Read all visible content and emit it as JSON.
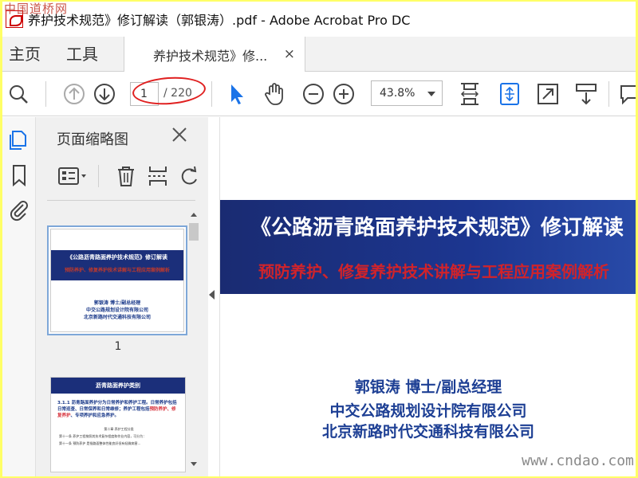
{
  "window": {
    "title": "养护技术规范》修订解读（郭银涛）.pdf - Adobe Acrobat Pro DC",
    "watermark_top": "中国道桥网",
    "watermark_bottom": "www.cndao.com"
  },
  "tabs": {
    "home": "主页",
    "tools": "工具",
    "document": "养护技术规范》修...",
    "close_glyph": "×"
  },
  "toolbar": {
    "current_page": "1",
    "total_pages": "/ 220",
    "zoom": "43.8%"
  },
  "thumbnails": {
    "title": "页面缩略图",
    "page1": {
      "title": "《公路沥青路面养护技术规范》修订解读",
      "subtitle": "预防养护、修复养护技术讲解与工程应用案例解析",
      "author": "郭银涛 博士/副总经理",
      "org1": "中交公路规划设计院有限公司",
      "org2": "北京新路时代交通科技有限公司",
      "number": "1"
    },
    "page2": {
      "heading": "沥青路面养护类别",
      "text_a": "3.1.1 沥青路面养护分为日常养护和养护工程。日常养护包括日常巡查、日常保养和日常维修；养护工程包括",
      "text_red": "预防养护、修复养护",
      "text_b": "、专项养护和应急养护。",
      "line1": "第二章 养护工程分类",
      "line2": "第十一条 养护工程按照其技术复杂程度和作业内容，可分为：",
      "line3": "第十一条 预防养护 是指路面整体性能良好但有轻微病害…"
    }
  },
  "document": {
    "title": "《公路沥青路面养护技术规范》修订解读",
    "subtitle": "预防养护、修复养护技术讲解与工程应用案例解析",
    "author": "郭银涛  博士/副总经理",
    "org1": "中交公路规划设计院有限公司",
    "org2": "北京新路时代交通科技有限公司"
  },
  "colors": {
    "banner_blue": "#1b2f7a",
    "subtitle_red": "#d1232a",
    "text_blue": "#1d3f94",
    "accent_blue": "#1a73e8"
  }
}
